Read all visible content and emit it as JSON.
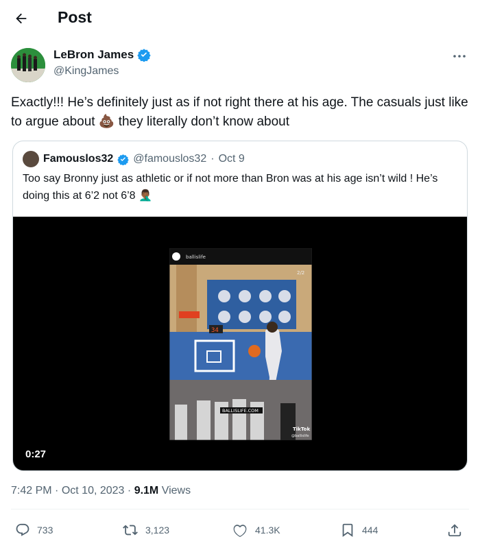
{
  "header": {
    "title": "Post"
  },
  "author": {
    "name": "LeBron James",
    "handle": "@KingJames"
  },
  "tweet": {
    "text": "Exactly!!! He’s definitely just as if not right there at his age. The casuals just like to argue about 💩 they literally don’t know about"
  },
  "quote": {
    "name": "Famouslos32",
    "handle": "@famouslos32",
    "separator": "·",
    "date": "Oct 9",
    "text": "Too say Bronny just as athletic or if not more than Bron was at his age isn’t wild ! He’s doing this at 6’2 not 6’8 🤦🏾‍♂️",
    "video_time": "0:27",
    "embedded": {
      "account": "ballislife",
      "page_indicator": "2/2",
      "shot_clock": "34",
      "banner": "BALLISLIFE.COM",
      "tiktok": "TikTok",
      "tiktok_handle": "@ballislife"
    }
  },
  "meta": {
    "time": "7:42 PM",
    "sep1": "·",
    "date": "Oct 10, 2023",
    "sep2": "·",
    "views_num": "9.1M",
    "views_label": "Views"
  },
  "actions": {
    "replies": "733",
    "reposts": "3,123",
    "likes": "41.3K",
    "bookmarks": "444"
  },
  "colors": {
    "text": "#0f1419",
    "secondary": "#536471",
    "verified": "#1d9bf0",
    "border": "#cfd9de"
  }
}
